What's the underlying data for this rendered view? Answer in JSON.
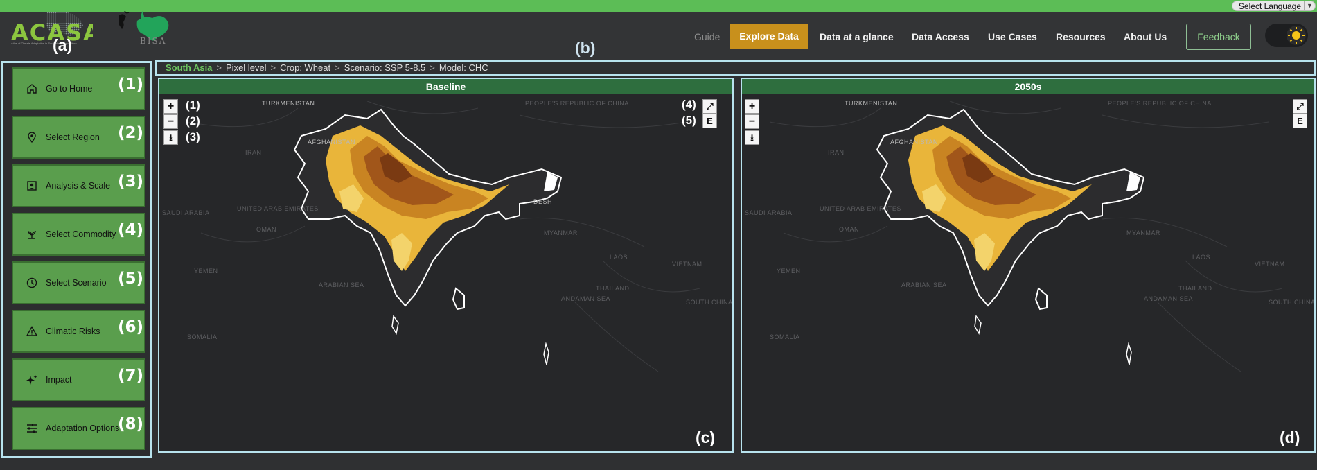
{
  "top_bar": {
    "language_select": "Select Language"
  },
  "logos": {
    "acasa": "ACASA",
    "acasa_tagline": "Atlas of Climate Adaptation in South Asian Agriculture",
    "bisa": "BISA"
  },
  "annotations": {
    "a": "(a)",
    "b": "(b)",
    "c": "(c)",
    "d": "(d)"
  },
  "nav": {
    "items": [
      "Guide",
      "Explore Data",
      "Data at a glance",
      "Data Access",
      "Use Cases",
      "Resources",
      "About Us"
    ],
    "feedback": "Feedback",
    "active": "Explore Data"
  },
  "sidebar": {
    "items": [
      {
        "label": "Go to Home",
        "num": "(1)",
        "icon": "home-icon"
      },
      {
        "label": "Select Region",
        "num": "(2)",
        "icon": "map-pin-icon"
      },
      {
        "label": "Analysis & Scale",
        "num": "(3)",
        "icon": "analysis-icon"
      },
      {
        "label": "Select Commodity",
        "num": "(4)",
        "icon": "plant-icon"
      },
      {
        "label": "Select Scenario",
        "num": "(5)",
        "icon": "clock-icon"
      },
      {
        "label": "Climatic Risks",
        "num": "(6)",
        "icon": "warning-icon"
      },
      {
        "label": "Impact",
        "num": "(7)",
        "icon": "sparkle-icon"
      },
      {
        "label": "Adaptation Options",
        "num": "(8)",
        "icon": "sliders-icon"
      }
    ]
  },
  "breadcrumb": {
    "region": "South Asia",
    "level": "Pixel level",
    "crop": "Crop: Wheat",
    "scenario": "Scenario: SSP 5-8.5",
    "model": "Model: CHC"
  },
  "panels": [
    {
      "title": "Baseline",
      "label": "(c)",
      "controls": {
        "zoom_in": "+",
        "zoom_out": "−",
        "download": "⭳",
        "fullscreen": "⤢",
        "export": "E"
      },
      "control_labels": [
        "(1)",
        "(2)",
        "(3)",
        "(4)",
        "(5)"
      ]
    },
    {
      "title": "2050s",
      "label": "(d)",
      "controls": {
        "zoom_in": "+",
        "zoom_out": "−",
        "download": "⭳",
        "fullscreen": "⤢",
        "export": "E"
      }
    }
  ],
  "map_labels": [
    "TURKMENISTAN",
    "AFGHANISTAN",
    "IRAN",
    "PEOPLE'S REPUBLIC OF CHINA",
    "UNITED ARAB EMIRATES",
    "SAUDI ARABIA",
    "OMAN",
    "YEMEN",
    "MYANMAR",
    "LAOS",
    "VIETNAM",
    "THAILAND",
    "ARABIAN SEA",
    "ANDAMAN SEA",
    "SOUTH CHINA SEA",
    "SOMALIA",
    "DESH"
  ],
  "colors": {
    "accent": "#c8901c",
    "sidebar_btn": "#5a9e4d",
    "header_green": "#2e6e3e",
    "outline": "#b8e3ee"
  }
}
